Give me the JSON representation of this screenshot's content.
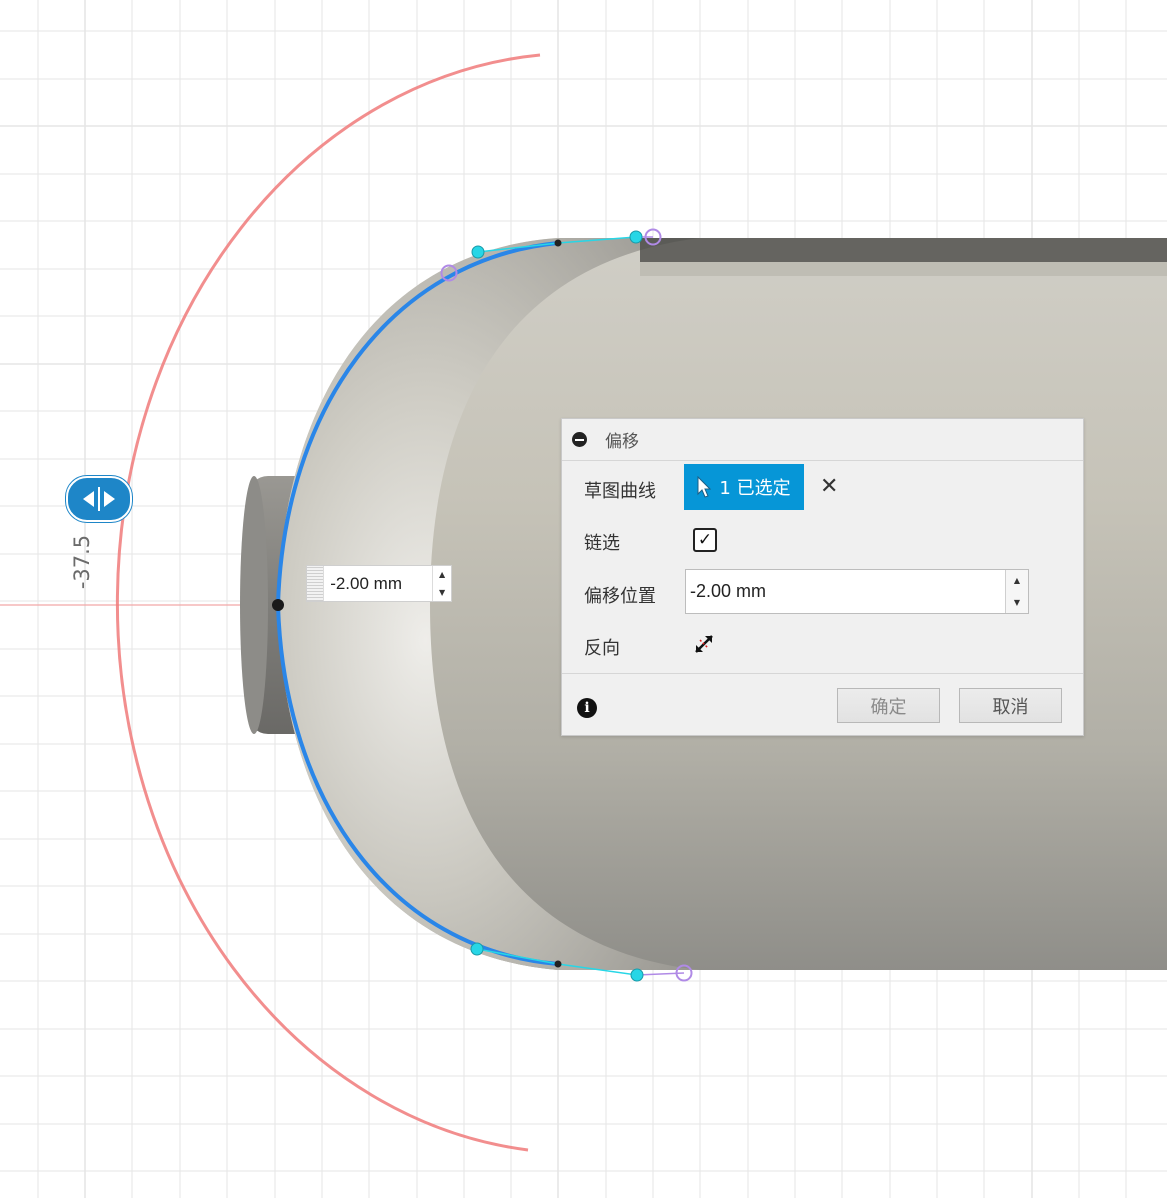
{
  "sketch": {
    "dimension_value": "-37.5",
    "onscreen_offset_value": "-2.00 mm",
    "colors": {
      "grid": "#e6e6e6",
      "axis": "#f4a5a5",
      "offset_arc": "#f07878",
      "selected_curve": "#2a86e8",
      "spline_handle": "#27d6e6",
      "constraint_point": "#b08ae6",
      "body": "#b8b6ae"
    }
  },
  "dialog": {
    "title": "偏移",
    "sketch_curves_label": "草图曲线",
    "selection_label": "1 已选定",
    "chain_label": "链选",
    "chain_checked": true,
    "offset_position_label": "偏移位置",
    "offset_position_value": "-2.00 mm",
    "flip_label": "反向",
    "ok_label": "确定",
    "cancel_label": "取消"
  },
  "icons": {
    "collapse": "minus-circle-icon",
    "select": "cursor-arrow-icon",
    "clear": "close-icon",
    "flip": "flip-direction-icon",
    "info": "info-icon",
    "handle": "flip-arrows-icon"
  }
}
